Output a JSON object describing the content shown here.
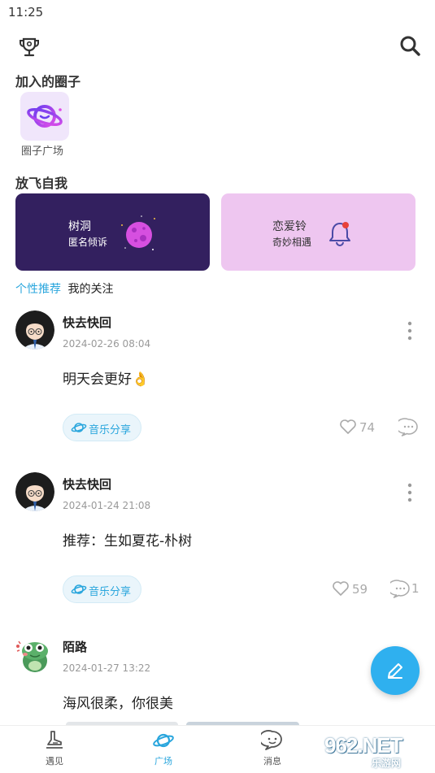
{
  "status_bar": {
    "time": "11:25"
  },
  "header": {
    "left_icon": "trophy-icon",
    "right_icon": "search-icon"
  },
  "joined_section": {
    "title": "加入的圈子",
    "items": [
      {
        "label": "圈子广场",
        "icon": "planet-icon"
      }
    ]
  },
  "fly_section": {
    "title": "放飞自我",
    "cards": [
      {
        "title": "树洞",
        "subtitle": "匿名倾诉",
        "color": "#33205f"
      },
      {
        "title": "恋爱铃",
        "subtitle": "奇妙相遇",
        "color": "#eec6f0"
      }
    ]
  },
  "tabs": [
    {
      "label": "个性推荐",
      "active": true
    },
    {
      "label": "我的关注",
      "active": false
    }
  ],
  "posts": [
    {
      "author": "快去快回",
      "time": "2024-02-26 08:04",
      "text": "明天会更好👌",
      "tag": "音乐分享",
      "likes": "74",
      "comments": ""
    },
    {
      "author": "快去快回",
      "time": "2024-01-24 21:08",
      "text": "推荐：生如夏花-朴树",
      "tag": "音乐分享",
      "likes": "59",
      "comments": "1"
    },
    {
      "author": "陌路",
      "time": "2024-01-27 13:22",
      "text": "海风很柔，你很美"
    }
  ],
  "bottom_nav": [
    {
      "label": "遇见",
      "icon": "footprint-icon",
      "active": false
    },
    {
      "label": "广场",
      "icon": "planet-icon",
      "active": true
    },
    {
      "label": "消息",
      "icon": "chat-icon",
      "active": false
    }
  ],
  "watermark": {
    "text": "962.NET",
    "sub": "乐游网"
  },
  "colors": {
    "accent": "#2aa6dd",
    "fab": "#2fb0ef"
  }
}
